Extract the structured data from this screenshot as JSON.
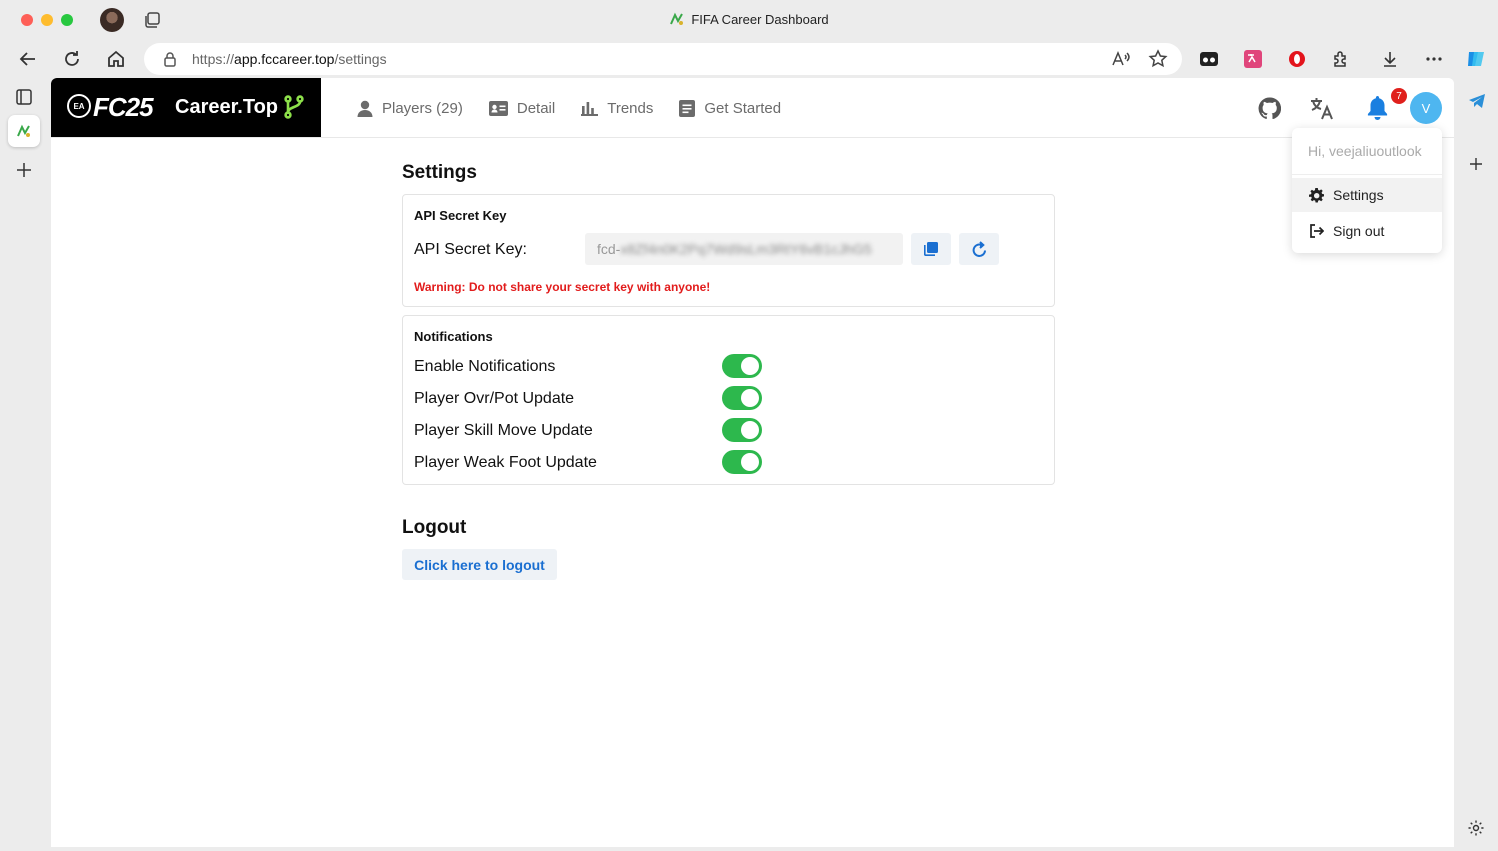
{
  "browser": {
    "window_title": "FIFA Career Dashboard",
    "url_prefix": "https://",
    "url_domain": "app.fccareer.top",
    "url_path": "/settings"
  },
  "brand": {
    "ea_label": "EA",
    "logo_text": "FC25",
    "name": "Career.Top"
  },
  "nav": {
    "items": [
      {
        "label": "Players (29)",
        "icon": "person-icon"
      },
      {
        "label": "Detail",
        "icon": "id-card-icon"
      },
      {
        "label": "Trends",
        "icon": "bar-chart-icon"
      },
      {
        "label": "Get Started",
        "icon": "document-icon"
      }
    ]
  },
  "header": {
    "notification_count": "7",
    "avatar_initial": "V"
  },
  "dropdown": {
    "greeting": "Hi, veejaliuoutlook",
    "items": [
      {
        "label": "Settings",
        "icon": "gear-icon"
      },
      {
        "label": "Sign out",
        "icon": "sign-out-icon"
      }
    ]
  },
  "settings": {
    "heading": "Settings",
    "api": {
      "section_title": "API Secret Key",
      "label": "API Secret Key:",
      "value_prefix": "fcd-",
      "value_masked": "x8Zf4n0K2Pq7Wd9sLm3RtY6vB1cJhG5",
      "warning": "Warning: Do not share your secret key with anyone!"
    },
    "notifications": {
      "section_title": "Notifications",
      "toggles": [
        {
          "label": "Enable Notifications",
          "on": true
        },
        {
          "label": "Player Ovr/Pot Update",
          "on": true
        },
        {
          "label": "Player Skill Move Update",
          "on": true
        },
        {
          "label": "Player Weak Foot Update",
          "on": true
        }
      ]
    },
    "logout": {
      "heading": "Logout",
      "button_label": "Click here to logout"
    }
  },
  "colors": {
    "toggle_on": "#2db84d",
    "link_blue": "#1a6fd1",
    "warning_red": "#e21c1c",
    "avatar_bg": "#4eb6f0",
    "badge_red": "#e0201c"
  }
}
